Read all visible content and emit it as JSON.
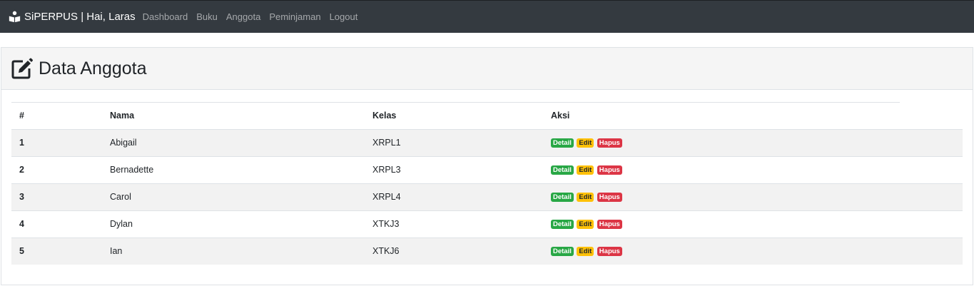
{
  "navbar": {
    "brand": "SiPERPUS | Hai, Laras",
    "links": [
      "Dashboard",
      "Buku",
      "Anggota",
      "Peminjaman",
      "Logout"
    ]
  },
  "page": {
    "title": "Data Anggota"
  },
  "table": {
    "headers": [
      "#",
      "Nama",
      "Kelas",
      "Aksi"
    ],
    "rows": [
      {
        "no": "1",
        "nama": "Abigail",
        "kelas": "XRPL1"
      },
      {
        "no": "2",
        "nama": "Bernadette",
        "kelas": "XRPL3"
      },
      {
        "no": "3",
        "nama": "Carol",
        "kelas": "XRPL4"
      },
      {
        "no": "4",
        "nama": "Dylan",
        "kelas": "XTKJ3"
      },
      {
        "no": "5",
        "nama": "Ian",
        "kelas": "XTKJ6"
      }
    ],
    "actions": {
      "detail": "Detail",
      "edit": "Edit",
      "hapus": "Hapus"
    }
  },
  "icons": {
    "brand": "reader-icon",
    "header": "edit-icon"
  },
  "colors": {
    "navbar": "#343a40",
    "detail": "#28a745",
    "edit": "#ffc107",
    "hapus": "#dc3545"
  }
}
